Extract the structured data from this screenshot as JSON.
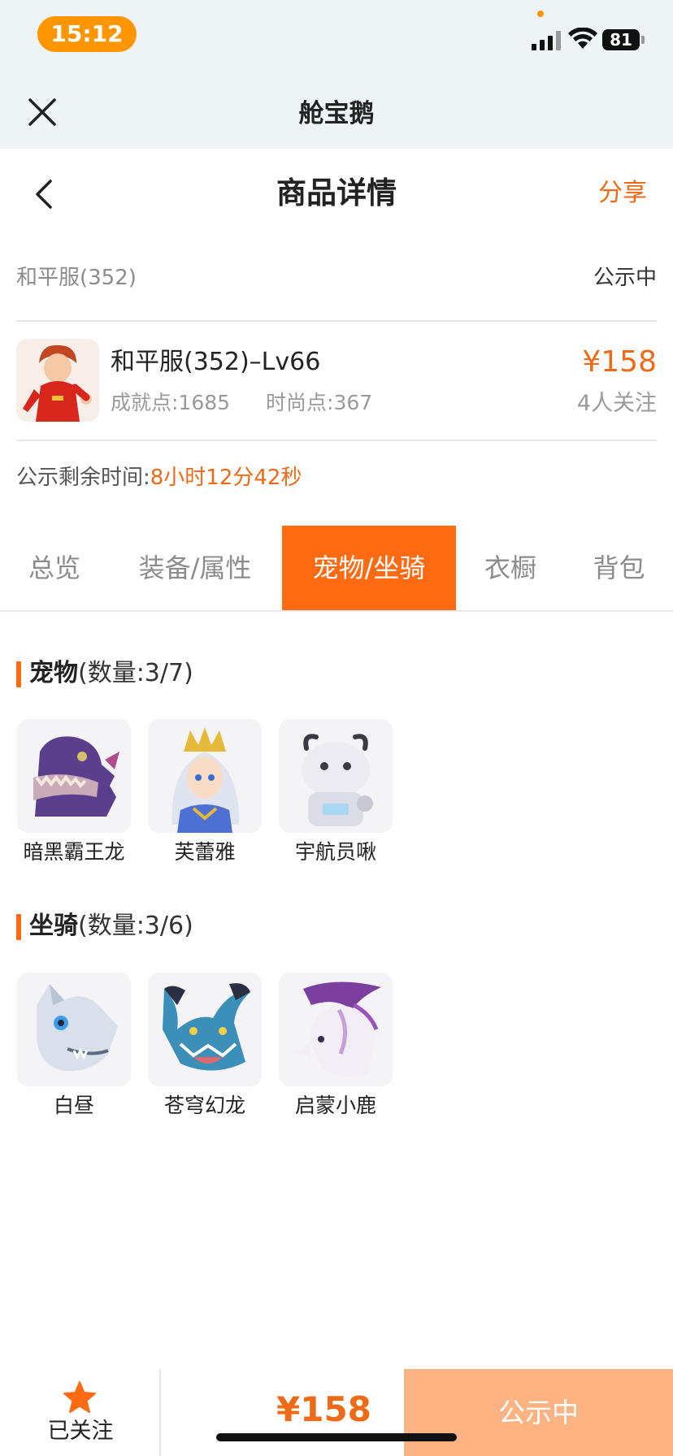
{
  "status_bar": {
    "time": "15:12",
    "battery": "81"
  },
  "miniapp": {
    "title": "舱宝鹅"
  },
  "header": {
    "title": "商品详情",
    "share_label": "分享"
  },
  "server": {
    "name": "和平服(352)",
    "status": "公示中"
  },
  "product": {
    "name": "和平服(352)–Lv66",
    "achievement": "成就点:1685",
    "fashion": "时尚点:367",
    "price": "¥158",
    "followers": "4人关注"
  },
  "countdown": {
    "label": "公示剩余时间:",
    "value": "8小时12分42秒"
  },
  "tabs": [
    {
      "label": "总览",
      "active": false
    },
    {
      "label": "装备/属性",
      "active": false
    },
    {
      "label": "宠物/坐骑",
      "active": true
    },
    {
      "label": "衣橱",
      "active": false
    },
    {
      "label": "背包",
      "active": false
    }
  ],
  "pets": {
    "title": "宠物",
    "count": "(数量:3/7)",
    "items": [
      {
        "name": "暗黑霸王龙"
      },
      {
        "name": "芙蕾雅"
      },
      {
        "name": "宇航员啾"
      }
    ]
  },
  "mounts": {
    "title": "坐骑",
    "count": "(数量:3/6)",
    "items": [
      {
        "name": "白昼"
      },
      {
        "name": "苍穹幻龙"
      },
      {
        "name": "启蒙小鹿"
      }
    ]
  },
  "bottom": {
    "follow_label": "已关注",
    "price": "¥158",
    "action_label": "公示中"
  },
  "colors": {
    "accent": "#ff6a13",
    "price": "#ee6a16",
    "action_button": "#fdb282"
  }
}
